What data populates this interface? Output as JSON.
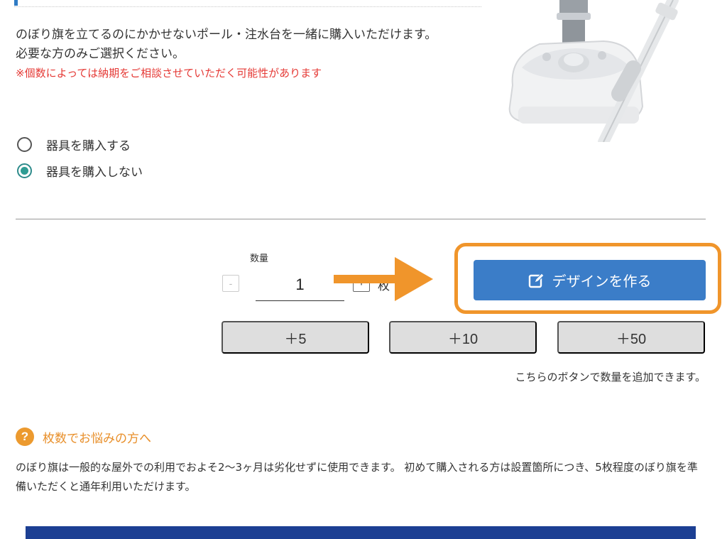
{
  "intro": {
    "line1": "のぼり旗を立てるのにかかせないポール・注水台を一緒に購入いただけます。",
    "line2": "必要な方のみご選択ください。",
    "warning": "※個数によっては納期をご相談させていただく可能性があります"
  },
  "options": [
    {
      "label": "器具を購入する",
      "checked": false
    },
    {
      "label": "器具を購入しない",
      "checked": true
    }
  ],
  "quantity": {
    "label": "数量",
    "value": "1",
    "minus": "-",
    "plus": "+",
    "unit": "枚"
  },
  "design_button": {
    "label": "デザインを作る"
  },
  "add_buttons": [
    "＋5",
    "＋10",
    "＋50"
  ],
  "add_note": "こちらのボタンで数量を追加できます。",
  "help": {
    "icon": "?",
    "title": "枚数でお悩みの方へ",
    "body": "のぼり旗は一般的な屋外での利用でおよそ2〜3ヶ月は劣化せずに使用できます。 初めて購入される方は設置箇所につき、5枚程度のぼり旗を準備いただくと通年利用いただけます。"
  },
  "colors": {
    "accent_orange": "#f0952b",
    "button_blue": "#3b7dc8",
    "warning_red": "#e53935",
    "radio_teal": "#2e9c93"
  }
}
